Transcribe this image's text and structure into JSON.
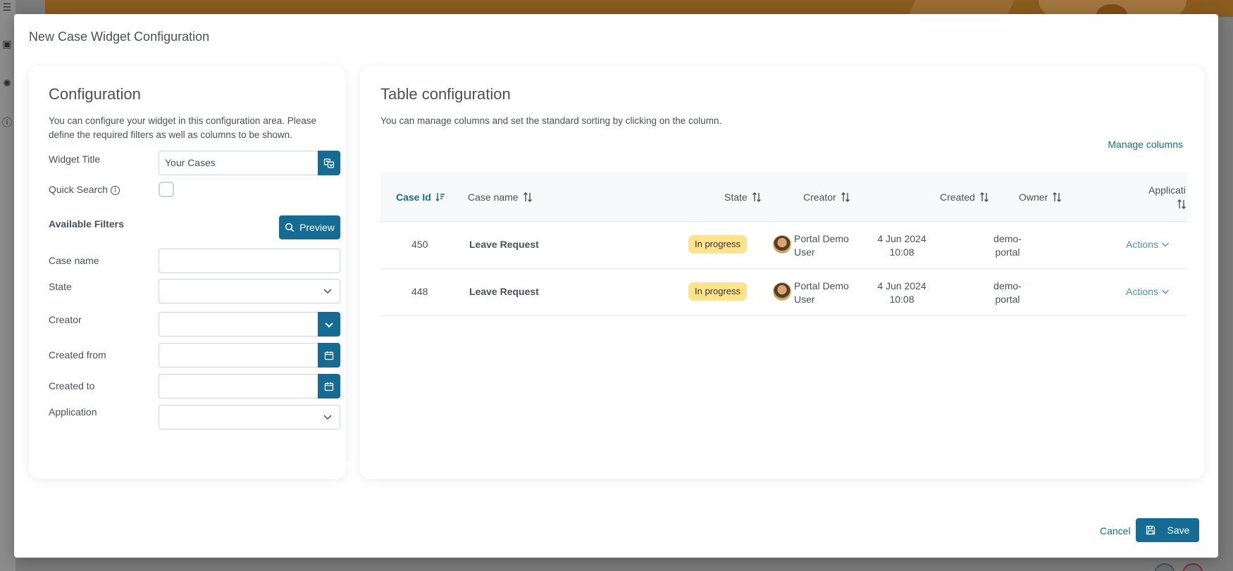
{
  "dialog": {
    "title": "New Case Widget Configuration"
  },
  "config": {
    "title": "Configuration",
    "description": "You can configure your widget in this configuration area. Please define the required filters as well as columns to be shown.",
    "widget_title_label": "Widget Title",
    "widget_title_value": "Your Cases",
    "quick_search_label": "Quick Search",
    "quick_search_checked": false,
    "available_filters_label": "Available Filters",
    "preview_label": "Preview",
    "filters": {
      "case_name_label": "Case name",
      "state_label": "State",
      "creator_label": "Creator",
      "created_from_label": "Created from",
      "created_to_label": "Created to",
      "application_label": "Application"
    }
  },
  "table_config": {
    "title": "Table configuration",
    "description": "You can manage columns and set the standard sorting by clicking on the column.",
    "manage_columns_label": "Manage columns",
    "columns": {
      "case_id": "Case Id",
      "case_name": "Case name",
      "state": "State",
      "creator": "Creator",
      "created": "Created",
      "owner": "Owner",
      "application": "Applicati"
    },
    "rows": [
      {
        "case_id": "450",
        "case_name": "Leave Request",
        "state": "In progress",
        "creator_line1": "Portal Demo",
        "creator_line2": "User",
        "created_line1": "4 Jun 2024",
        "created_line2": "10:08",
        "owner_line1": "demo-",
        "owner_line2": "portal",
        "actions": "Actions"
      },
      {
        "case_id": "448",
        "case_name": "Leave Request",
        "state": "In progress",
        "creator_line1": "Portal Demo",
        "creator_line2": "User",
        "created_line1": "4 Jun 2024",
        "created_line2": "10:08",
        "owner_line1": "demo-",
        "owner_line2": "portal",
        "actions": "Actions"
      }
    ]
  },
  "footer": {
    "cancel_label": "Cancel",
    "save_label": "Save"
  },
  "colors": {
    "primary": "#146c94",
    "badge_in_progress": "#ffe38a",
    "link_actions": "#4a90c2"
  }
}
